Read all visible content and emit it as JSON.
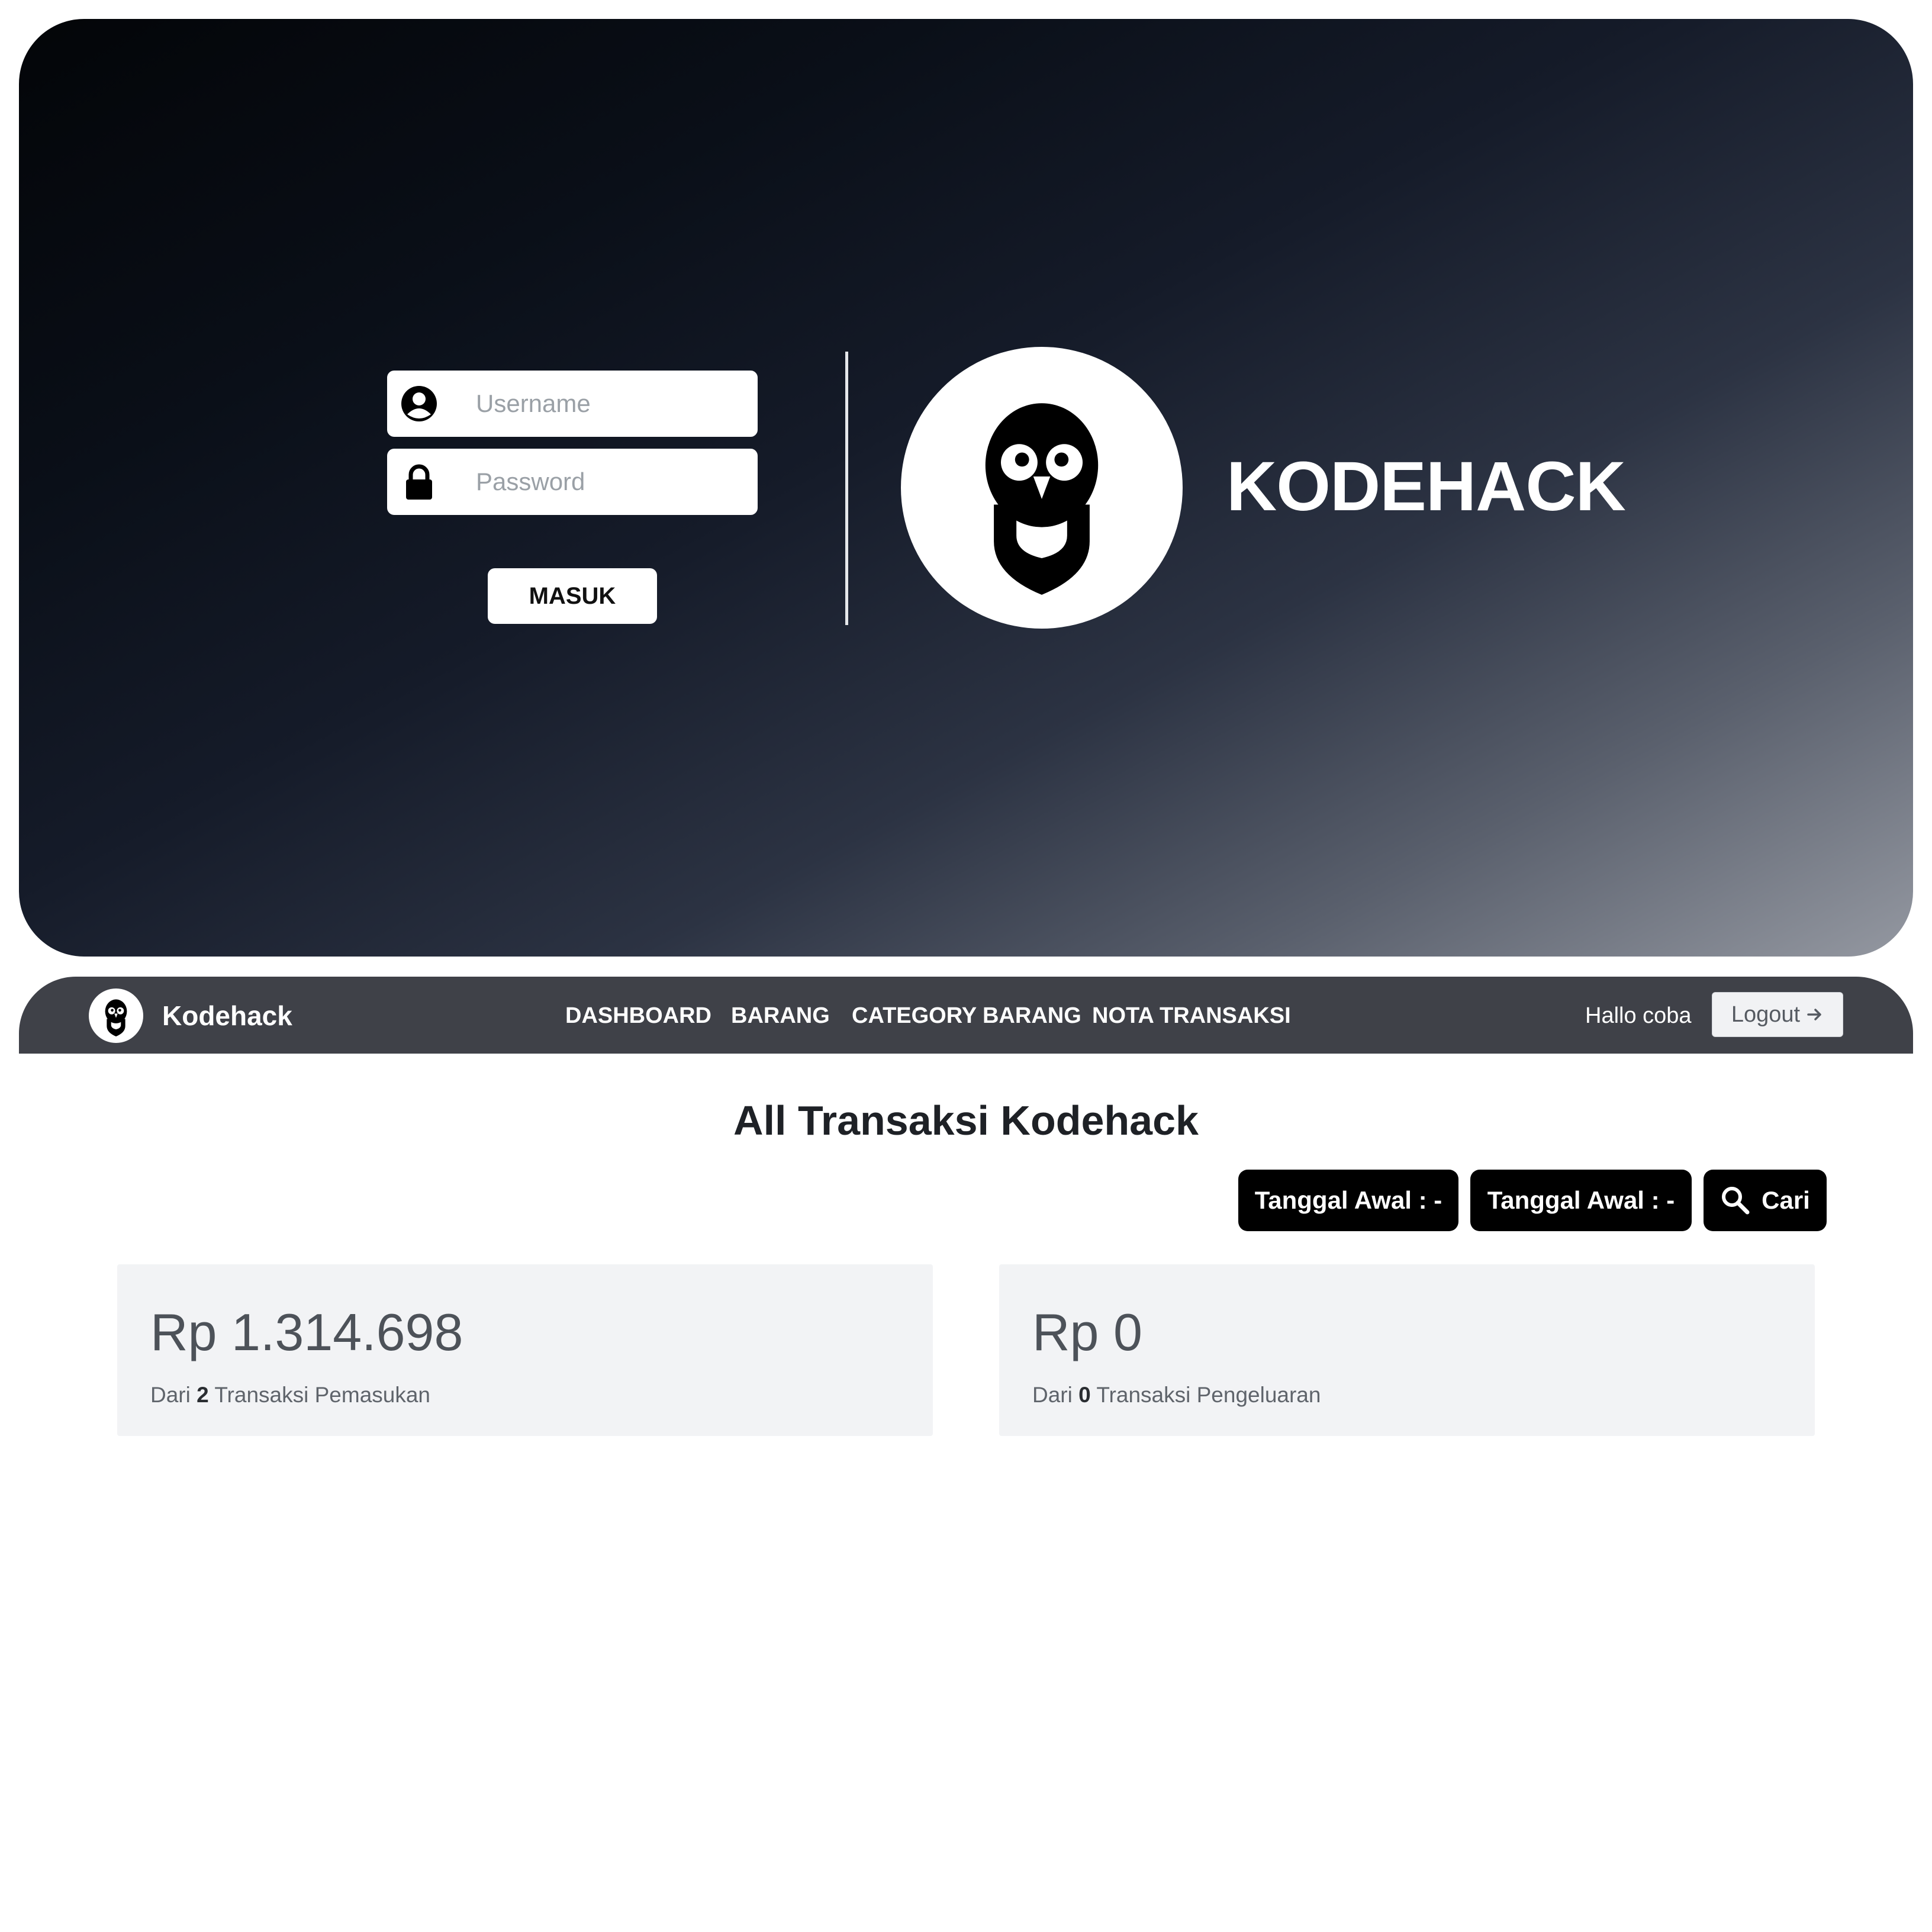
{
  "login": {
    "username_placeholder": "Username",
    "password_placeholder": "Password",
    "submit_label": "MASUK",
    "brand": "KODEHACK"
  },
  "navbar": {
    "brand": "Kodehack",
    "items": [
      "DASHBOARD",
      "BARANG",
      "CATEGORY BARANG",
      "NOTA TRANSAKSI"
    ],
    "greeting": "Hallo coba",
    "logout_label": "Logout"
  },
  "main": {
    "title": "All Transaksi Kodehack",
    "filters": {
      "start_date_label": "Tanggal Awal : -",
      "end_date_label": "Tanggal Awal : -",
      "search_label": "Cari"
    },
    "cards": [
      {
        "amount": "Rp 1.314.698",
        "prefix": "Dari",
        "count": "2",
        "suffix": "Transaksi Pemasukan"
      },
      {
        "amount": "Rp 0",
        "prefix": "Dari",
        "count": "0",
        "suffix": "Transaksi Pengeluaran"
      }
    ]
  },
  "icons": {
    "username": "user-circle-icon",
    "password": "lock-icon",
    "logo": "owl-logo-icon",
    "logout": "arrow-right-icon",
    "search": "search-icon"
  },
  "colors": {
    "navbar": "#3f4148",
    "pill": "#000000",
    "card": "#f2f3f5"
  }
}
